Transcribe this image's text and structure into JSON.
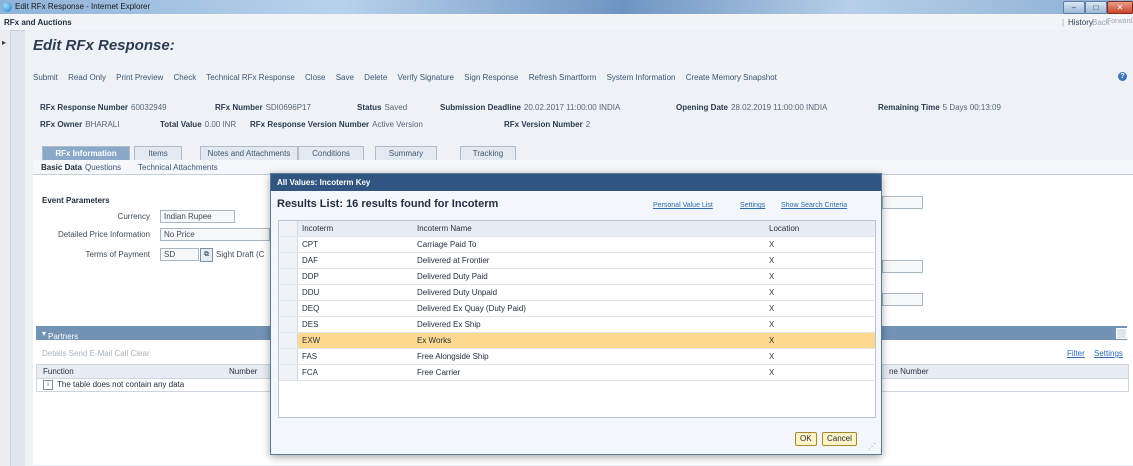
{
  "window": {
    "title": "Edit RFx Response - Internet Explorer",
    "minimize": "–",
    "maximize": "□",
    "close": "✕"
  },
  "menubar": {
    "app_title": "RFx and Auctions",
    "history": "History",
    "back": "Back",
    "forward": "Forward"
  },
  "page": {
    "title": "Edit RFx Response:",
    "toolbar": [
      "Submit",
      "Read Only",
      "Print Preview",
      "Check",
      "Technical RFx Response",
      "Close",
      "Save",
      "Delete",
      "Verify Signature",
      "Sign Response",
      "Refresh Smartform",
      "System Information",
      "Create Memory Snapshot"
    ],
    "header": {
      "response_number_label": "RFx Response Number",
      "response_number": "60032949",
      "rfx_number_label": "RFx Number",
      "rfx_number": "SDI0696P17",
      "status_label": "Status",
      "status": "Saved",
      "deadline_label": "Submission Deadline",
      "deadline": "20.02.2017 11:00:00 INDIA",
      "opening_label": "Opening Date",
      "opening": "28.02.2019 11:00:00 INDIA",
      "remaining_label": "Remaining Time",
      "remaining": "5 Days 00:13:09",
      "owner_label": "RFx Owner",
      "owner": "BHARALI",
      "total_label": "Total Value",
      "total": "0.00 INR",
      "resp_version_label": "RFx Response Version Number",
      "resp_version": "Active Version",
      "version_label": "RFx Version Number",
      "version": "2"
    },
    "tabs": [
      "RFx Information",
      "Items",
      "Notes and Attachments",
      "Conditions",
      "Summary",
      "Tracking"
    ],
    "subtabs": [
      "Basic Data",
      "Questions",
      "Technical Attachments"
    ],
    "event_params": {
      "heading": "Event Parameters",
      "currency_label": "Currency",
      "currency": "Indian Rupee",
      "detailed_price_label": "Detailed Price Information",
      "detailed_price": "No Price",
      "payment_label": "Terms of Payment",
      "payment_code": "SD",
      "payment_text": "Sight Draft (C"
    },
    "partners": {
      "heading": "Partners and Delivery Information",
      "actions": "Details  Send E-Mail  Call  Clear",
      "filter": "Filter",
      "settings": "Settings",
      "col_function": "Function",
      "col_number": "Number",
      "col_phone": "ne Number",
      "empty": "The table does not contain any data"
    }
  },
  "dialog": {
    "title": "All Values: Incoterm Key",
    "results": "Results List: 16 results found for Incoterm",
    "links": [
      "Personal Value List",
      "Settings",
      "Show Search Criteria"
    ],
    "columns": [
      "Incoterm",
      "Incoterm Name",
      "Location"
    ],
    "rows": [
      {
        "code": "CPT",
        "name": "Carriage Paid To",
        "loc": "X"
      },
      {
        "code": "DAF",
        "name": "Delivered at Frontier",
        "loc": "X"
      },
      {
        "code": "DDP",
        "name": "Delivered Duty Paid",
        "loc": "X"
      },
      {
        "code": "DDU",
        "name": "Delivered Duty Unpaid",
        "loc": "X"
      },
      {
        "code": "DEQ",
        "name": "Delivered Ex Quay (Duty Paid)",
        "loc": "X"
      },
      {
        "code": "DES",
        "name": "Delivered Ex Ship",
        "loc": "X"
      },
      {
        "code": "EXW",
        "name": "Ex Works",
        "loc": "X"
      },
      {
        "code": "FAS",
        "name": "Free Alongside Ship",
        "loc": "X"
      },
      {
        "code": "FCA",
        "name": "Free Carrier",
        "loc": "X"
      }
    ],
    "ok": "OK",
    "cancel": "Cancel"
  }
}
